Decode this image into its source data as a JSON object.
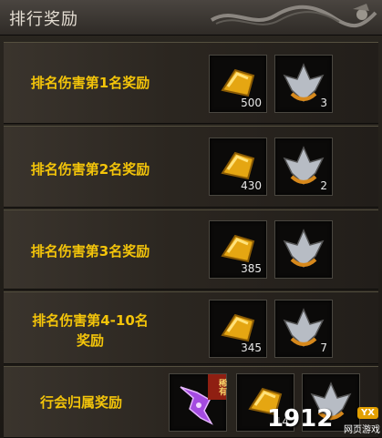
{
  "panel": {
    "title": "排行奖励"
  },
  "rows": [
    {
      "label": "排名伤害第1名奖励",
      "items": [
        {
          "icon": "gold-ingot-icon",
          "qty": "500"
        },
        {
          "icon": "silver-crest-icon",
          "qty": "3"
        }
      ]
    },
    {
      "label": "排名伤害第2名奖励",
      "items": [
        {
          "icon": "gold-ingot-icon",
          "qty": "430"
        },
        {
          "icon": "silver-crest-icon",
          "qty": "2"
        }
      ]
    },
    {
      "label": "排名伤害第3名奖励",
      "items": [
        {
          "icon": "gold-ingot-icon",
          "qty": "385"
        },
        {
          "icon": "silver-crest-icon",
          "qty": ""
        }
      ]
    },
    {
      "label_line1": "排名伤害第4-10名",
      "label_line2": "奖励",
      "items": [
        {
          "icon": "gold-ingot-icon",
          "qty": "345"
        },
        {
          "icon": "silver-crest-icon",
          "qty": "7"
        }
      ]
    },
    {
      "label": "行会归属奖励",
      "items": [
        {
          "icon": "purple-gem-icon",
          "tag": "稀有"
        },
        {
          "icon": "gold-ingot-icon",
          "qty": "14"
        },
        {
          "icon": "silver-crest-icon",
          "qty": ""
        }
      ]
    }
  ],
  "watermark": {
    "number": "1912",
    "badge": "YX",
    "sub": "网页游戏"
  },
  "colors": {
    "label": "#f3c40a",
    "tag_bg": "#8f1f12"
  }
}
